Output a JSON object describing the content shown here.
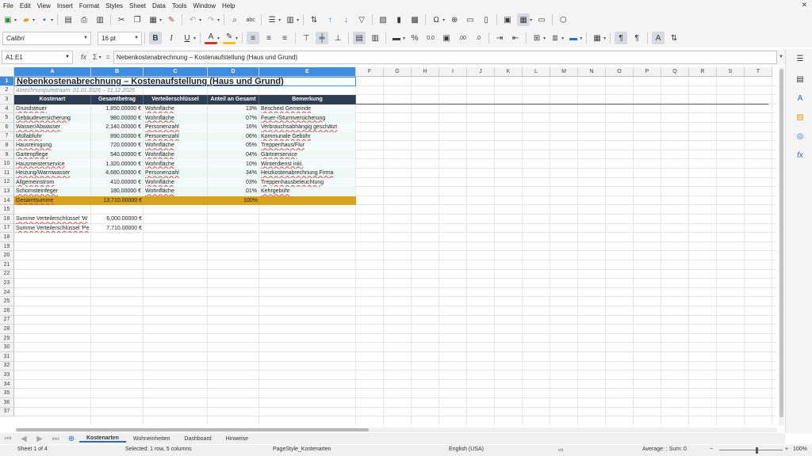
{
  "menu": [
    "File",
    "Edit",
    "View",
    "Insert",
    "Format",
    "Styles",
    "Sheet",
    "Data",
    "Tools",
    "Window",
    "Help"
  ],
  "font_name": "Calibri",
  "font_size": "16 pt",
  "name_box": "A1:E1",
  "formula_content": "Nebenkostenabrechnung – Kostenaufstellung (Haus und Grund)",
  "columns": [
    "A",
    "B",
    "C",
    "D",
    "E",
    "F",
    "G",
    "H",
    "I",
    "J",
    "K",
    "L",
    "M",
    "N",
    "O",
    "P",
    "Q",
    "R",
    "S",
    "T"
  ],
  "rows": [
    "1",
    "2",
    "3",
    "4",
    "5",
    "6",
    "7",
    "8",
    "9",
    "10",
    "11",
    "12",
    "13",
    "14",
    "15",
    "16",
    "17",
    "18",
    "19",
    "20",
    "21",
    "22",
    "23",
    "24",
    "25",
    "26",
    "27",
    "28",
    "29",
    "30",
    "31",
    "32",
    "33",
    "34",
    "35",
    "36",
    "37"
  ],
  "sheet": {
    "title": "Nebenkostenabrechnung – Kostenaufstellung (Haus und Grund)",
    "period": "Abrechnungszeitraum: 01.01.2026 – 31.12.2026",
    "headers": [
      "Kostenart",
      "Gesamtbetrag",
      "Verteilerschlüssel",
      "Anteil an Gesamt",
      "Bemerkung"
    ],
    "data_rows": [
      [
        "Grundsteuer",
        "1,850.00000 €",
        "Wohnfläche",
        "13%",
        "Bescheid Gemeinde"
      ],
      [
        "Gebäudeversicherung",
        "980.00000 €",
        "Wohnfläche",
        "07%",
        "Feuer-/Sturmversicherung"
      ],
      [
        "Wasser/Abwasser",
        "2,140.00000 €",
        "Personenzahl",
        "16%",
        "Verbrauchsabhängig geschätzt"
      ],
      [
        "Müllabfuhr",
        "890.00000 €",
        "Personenzahl",
        "06%",
        "Kommunale Gebühr"
      ],
      [
        "Hausreinigung",
        "720.00000 €",
        "Wohnfläche",
        "05%",
        "Treppenhaus/Flur"
      ],
      [
        "Gartenpflege",
        "540.00000 €",
        "Wohnfläche",
        "04%",
        "Gärtnerservice"
      ],
      [
        "Hausmeisterservice",
        "1,320.00000 €",
        "Wohnfläche",
        "10%",
        "Winterdienst inkl."
      ],
      [
        "Heizung/Warmwasser",
        "4,680.00000 €",
        "Personenzahl",
        "34%",
        "Heizkostenabrechnung Firma"
      ],
      [
        "Allgemeinstrom",
        "410.00000 €",
        "Wohnfläche",
        "03%",
        "Treppenhausbeleuchtung"
      ],
      [
        "Schornsteinfeger",
        "180.00000 €",
        "Wohnfläche",
        "01%",
        "Kehrgebühr"
      ]
    ],
    "total_label": "Gesamtsumme",
    "total_amount": "13,710.00000 €",
    "total_pct": "100%",
    "sum1_label": "Summe Verteilerschlüssel 'W",
    "sum1_value": "6,000.00000 €",
    "sum2_label": "Summe Verteilerschlüssel 'Pe",
    "sum2_value": "7,710.00000 €"
  },
  "tabs": [
    "Kostenarten",
    "Wohneinheiten",
    "Dashboard",
    "Hinweise"
  ],
  "status": {
    "sheet": "Sheet 1 of 4",
    "selection": "Selected: 1 row, 5 columns",
    "page_style": "PageStyle_Kostenarten",
    "language": "English (USA)",
    "summary": "Average: ; Sum: 0",
    "zoom": "100%"
  },
  "colors": {
    "header_fill": "#2e3d4f",
    "total_fill": "#d9a21b",
    "stripe_fill": "#eef8f5",
    "selection": "#3d8ce0"
  }
}
